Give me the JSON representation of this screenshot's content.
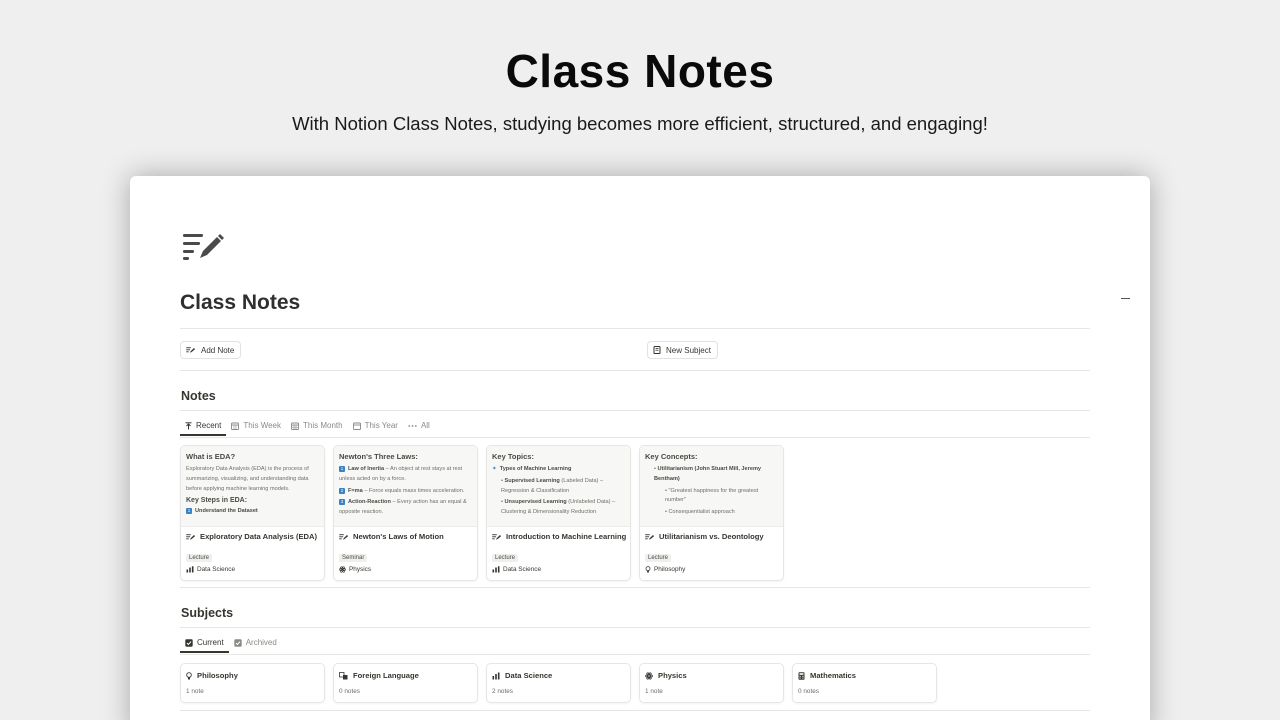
{
  "hero": {
    "title": "Class Notes",
    "subtitle": "With Notion Class Notes, studying becomes more efficient, structured, and engaging!"
  },
  "page": {
    "icon": "notes-edit-icon",
    "title": "Class Notes"
  },
  "actions": {
    "add_note": "Add Note",
    "new_subject": "New Subject"
  },
  "notes": {
    "title": "Notes",
    "tabs": [
      {
        "label": "Recent",
        "icon": "arrow-up-icon",
        "active": true
      },
      {
        "label": "This Week",
        "icon": "calendar-week-icon",
        "active": false
      },
      {
        "label": "This Month",
        "icon": "calendar-month-icon",
        "active": false
      },
      {
        "label": "This Year",
        "icon": "calendar-icon",
        "active": false
      },
      {
        "label": "All",
        "icon": "more-icon",
        "active": false
      }
    ],
    "cards": [
      {
        "preview": {
          "heading": "What is EDA?",
          "paragraph": "Exploratory Data Analysis (EDA) is the process of summarizing, visualizing, and understanding data before applying machine learning models.",
          "subheading": "Key Steps in EDA:",
          "item1_num": "1",
          "item1": "Understand the Dataset"
        },
        "title": "Exploratory Data Analysis (EDA)",
        "tag": "Lecture",
        "subject": "Data Science"
      },
      {
        "preview": {
          "heading": "Newton's Three Laws:",
          "item1_num": "1",
          "item1_bold": "Law of Inertia",
          "item1_rest": " – An object at rest stays at rest unless acted on by a force.",
          "item2_num": "2",
          "item2_bold": "F=ma",
          "item2_rest": " – Force equals mass times acceleration.",
          "item3_num": "3",
          "item3_bold": "Action-Reaction",
          "item3_rest": " – Every action has an equal & opposite reaction."
        },
        "title": "Newton's Laws of Motion",
        "tag": "Seminar",
        "subject": "Physics"
      },
      {
        "preview": {
          "heading": "Key Topics:",
          "item1": "Types of Machine Learning",
          "item2_bold": "Supervised Learning",
          "item2_rest": " (Labeled Data) – Regression & Classification",
          "item3_bold": "Unsupervised Learning",
          "item3_rest": " (Unlabeled Data) – Clustering & Dimensionality Reduction"
        },
        "title": "Introduction to Machine Learning",
        "tag": "Lecture",
        "subject": "Data Science"
      },
      {
        "preview": {
          "heading": "Key Concepts:",
          "item1_bold": "Utilitarianism (John Stuart Mill, Jeremy Bentham)",
          "item2": "\"Greatest happiness for the greatest number\"",
          "item3": "Consequentialist approach"
        },
        "title": "Utilitarianism vs. Deontology",
        "tag": "Lecture",
        "subject": "Philosophy"
      }
    ]
  },
  "subjects": {
    "title": "Subjects",
    "tabs": [
      {
        "label": "Current",
        "icon": "checkbox-icon",
        "active": true
      },
      {
        "label": "Archived",
        "icon": "checkbox-icon",
        "active": false
      }
    ],
    "items": [
      {
        "name": "Philosophy",
        "icon": "bulb-icon",
        "count": "1 note"
      },
      {
        "name": "Foreign Language",
        "icon": "translate-icon",
        "count": "0 notes"
      },
      {
        "name": "Data Science",
        "icon": "chart-icon",
        "count": "2 notes"
      },
      {
        "name": "Physics",
        "icon": "atom-icon",
        "count": "1 note"
      },
      {
        "name": "Mathematics",
        "icon": "calculator-icon",
        "count": "0 notes"
      }
    ]
  }
}
